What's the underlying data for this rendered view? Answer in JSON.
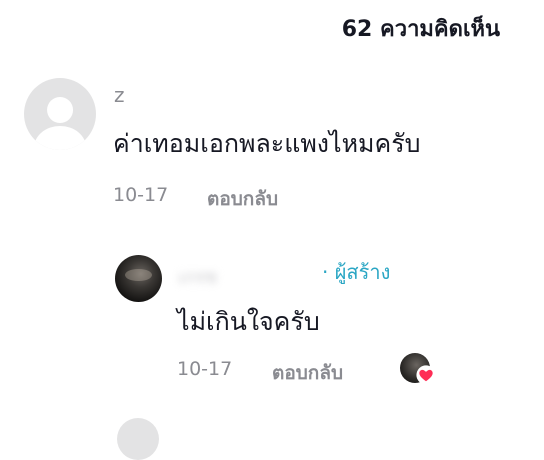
{
  "header": {
    "comment_count": "62 ความคิดเห็น"
  },
  "comments": [
    {
      "username": "z",
      "text": "ค่าเทอมเอกพละแพงไหมครับ",
      "date": "10-17",
      "reply_label": "ตอบกลับ",
      "avatar_icon": "default-user-icon"
    }
  ],
  "replies": [
    {
      "username_blurred": "เกรซ",
      "creator_badge": "· ผู้สร้าง",
      "text": "ไม่เกินใจครับ",
      "date": "10-17",
      "reply_label": "ตอบกลับ",
      "liked_by_creator_icon": "heart-icon",
      "heart_color": "#fe2c55",
      "badge_color": "#2aa6c4"
    }
  ]
}
